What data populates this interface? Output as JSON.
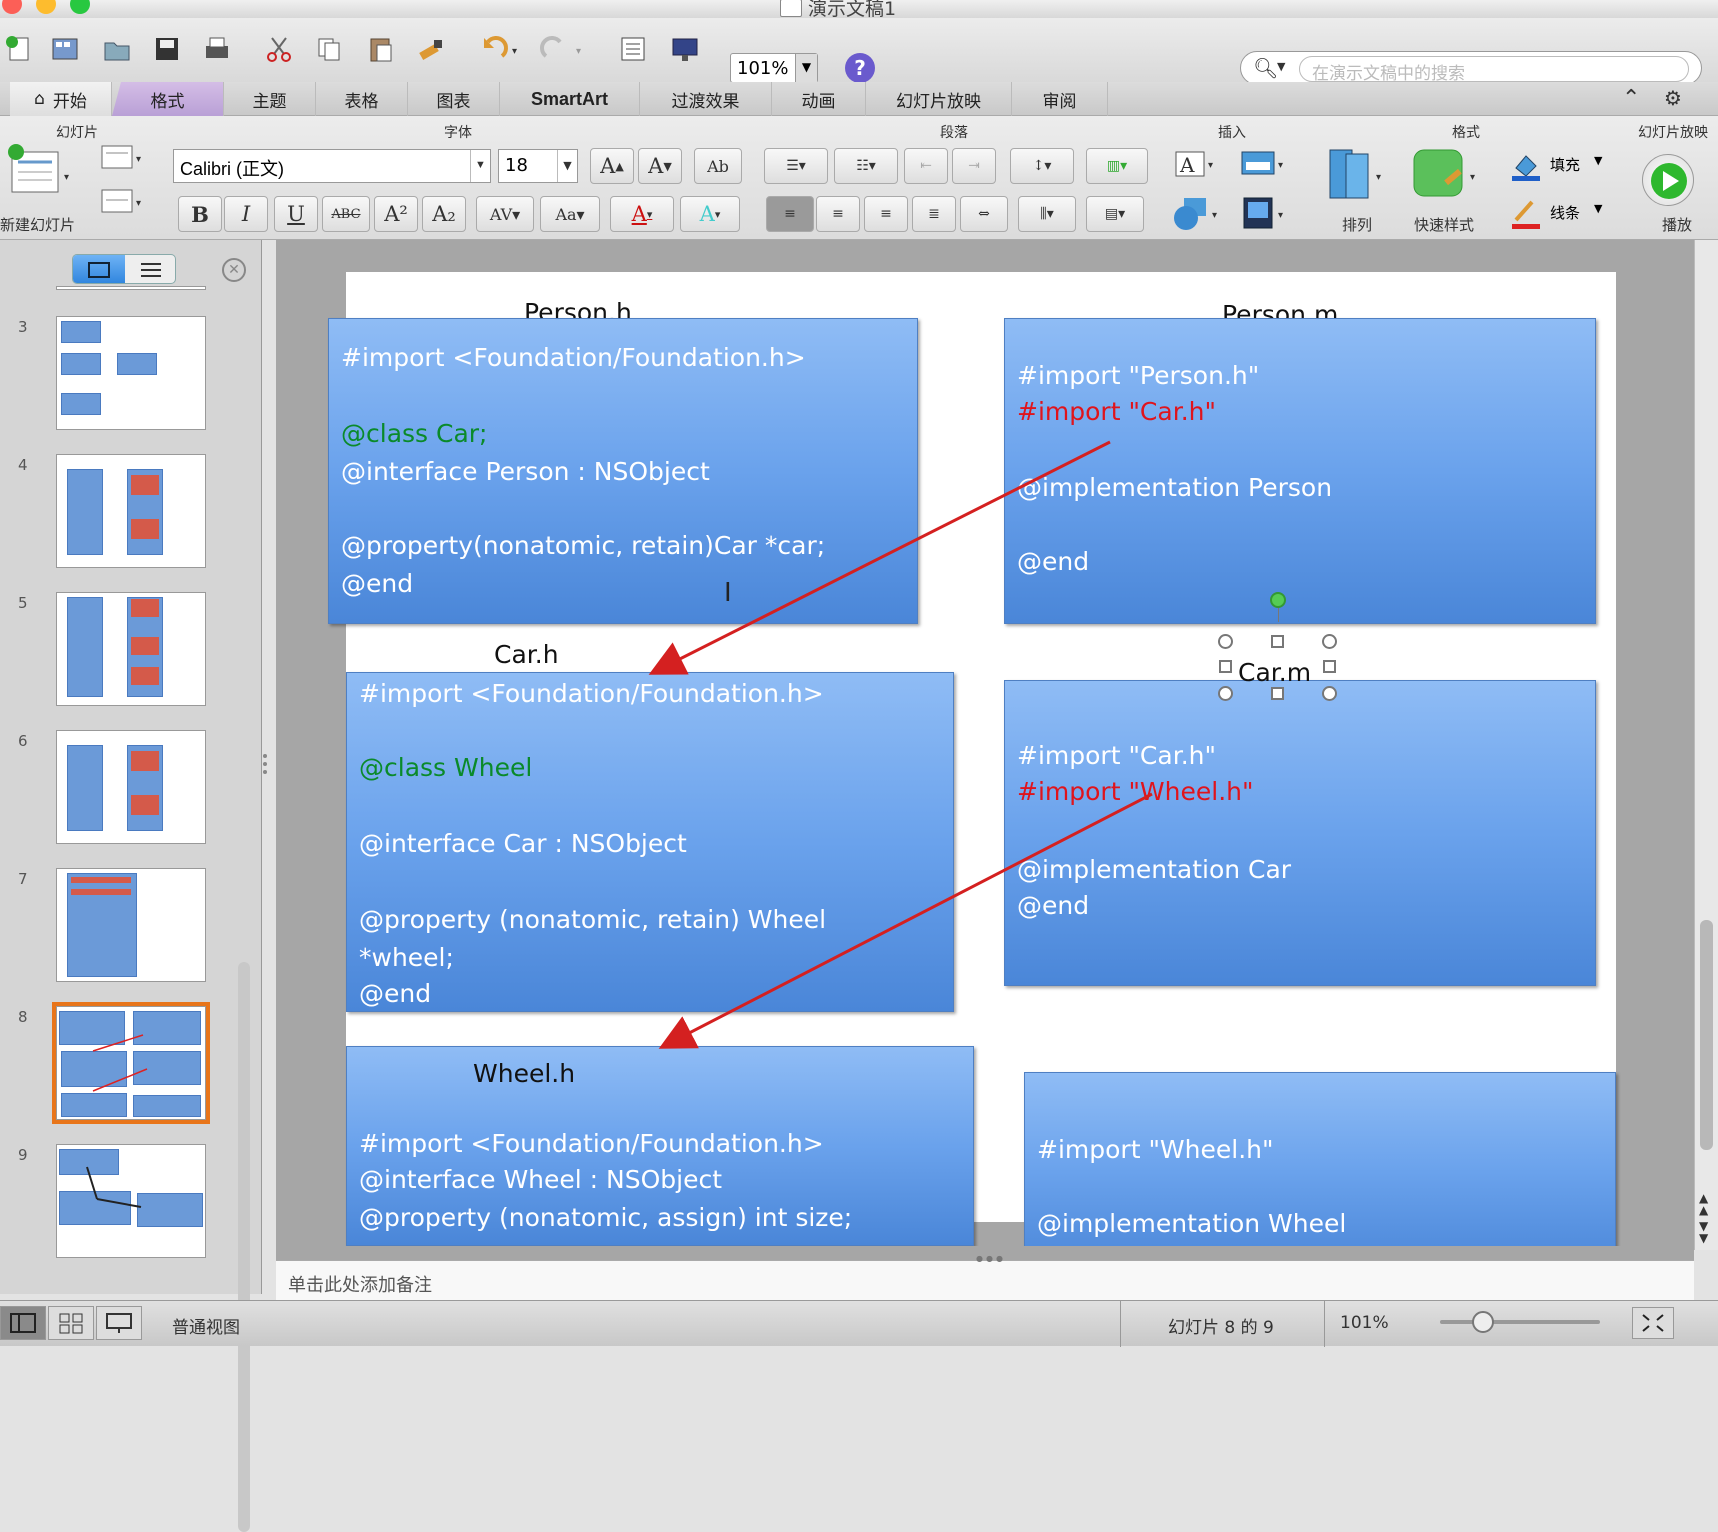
{
  "window": {
    "title": "演示文稿1"
  },
  "toolbar": {
    "zoom": "101%",
    "search_placeholder": "在演示文稿中的搜索"
  },
  "tabs": [
    "开始",
    "格式",
    "主题",
    "表格",
    "图表",
    "SmartArt",
    "过渡效果",
    "动画",
    "幻灯片放映",
    "审阅"
  ],
  "ribbon": {
    "groups": {
      "slides": "幻灯片",
      "font": "字体",
      "paragraph": "段落",
      "insert": "插入",
      "format": "格式",
      "slideshow": "幻灯片放映"
    },
    "new_slide": "新建幻灯片",
    "font_name": "Calibri (正文)",
    "font_size": "18",
    "arrange": "排列",
    "quick_styles": "快速样式",
    "fill": "填充",
    "line": "线条",
    "play": "播放",
    "format_buttons": [
      "B",
      "I",
      "U",
      "ABC",
      "A²",
      "A₂"
    ]
  },
  "thumbnails": {
    "numbers": [
      "3",
      "4",
      "5",
      "6",
      "7",
      "8",
      "9"
    ],
    "selected": "8"
  },
  "slide": {
    "person_h": {
      "title": "Person.h",
      "line1": "#import <Foundation/Foundation.h>",
      "line2": "@class Car;",
      "line3": "@interface Person : NSObject",
      "line4": "@property(nonatomic, retain)Car *car;",
      "line5": "@end"
    },
    "person_m": {
      "title": "Person.m",
      "line1": "#import \"Person.h\"",
      "line2": "#import \"Car.h\"",
      "line3": "@implementation Person",
      "line4": "@end"
    },
    "car_h": {
      "title": "Car.h",
      "line1": "#import <Foundation/Foundation.h>",
      "line2": "@class Wheel",
      "line3": "@interface Car : NSObject",
      "line4": "@property (nonatomic, retain) Wheel",
      "line5": "*wheel;",
      "line6": "@end"
    },
    "car_m": {
      "title": "Car.m",
      "line1": "#import \"Car.h\"",
      "line2": "#import \"Wheel.h\"",
      "line3": "@implementation Car",
      "line4": "@end"
    },
    "wheel_h": {
      "title": "Wheel.h",
      "line1": "#import <Foundation/Foundation.h>",
      "line2": "@interface Wheel : NSObject",
      "line3": "@property (nonatomic, assign) int size;"
    },
    "wheel_m": {
      "line1": "#import \"Wheel.h\"",
      "line2": "@implementation Wheel"
    }
  },
  "notes": {
    "placeholder": "单击此处添加备注"
  },
  "statusbar": {
    "view": "普通视图",
    "slide_info": "幻灯片 8 的 9",
    "zoom": "101%"
  },
  "colors": {
    "box_blue": "#6aa2ec",
    "green_keyword": "#0a8a2a",
    "red_import": "#e0141c",
    "arrow": "#d42020",
    "selected_thumb": "#e8751a"
  }
}
